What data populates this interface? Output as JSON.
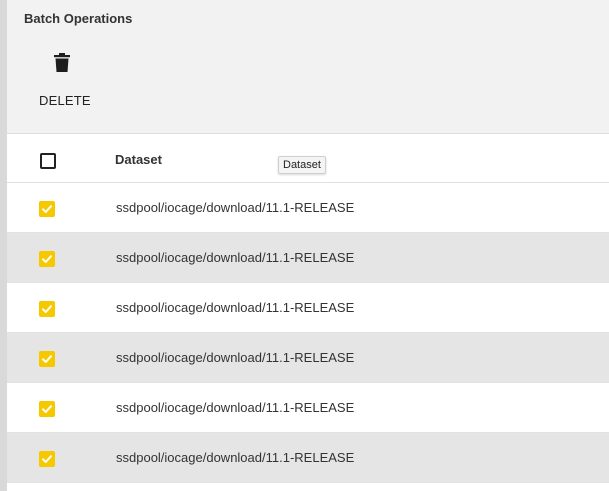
{
  "batch": {
    "title": "Batch Operations",
    "delete_label": "DELETE"
  },
  "table": {
    "header": {
      "column_dataset": "Dataset",
      "tooltip": "Dataset"
    },
    "rows": [
      {
        "dataset": "ssdpool/iocage/download/11.1-RELEASE",
        "checked": true
      },
      {
        "dataset": "ssdpool/iocage/download/11.1-RELEASE",
        "checked": true
      },
      {
        "dataset": "ssdpool/iocage/download/11.1-RELEASE",
        "checked": true
      },
      {
        "dataset": "ssdpool/iocage/download/11.1-RELEASE",
        "checked": true
      },
      {
        "dataset": "ssdpool/iocage/download/11.1-RELEASE",
        "checked": true
      },
      {
        "dataset": "ssdpool/iocage/download/11.1-RELEASE",
        "checked": true
      }
    ]
  },
  "icons": {
    "delete": "trash-icon",
    "checked": "checkbox-checked-icon",
    "unchecked": "checkbox-unchecked-icon"
  },
  "colors": {
    "checkbox_checked": "#f5c800",
    "row_alt": "#e5e5e5",
    "panel": "#f2f2f2"
  }
}
